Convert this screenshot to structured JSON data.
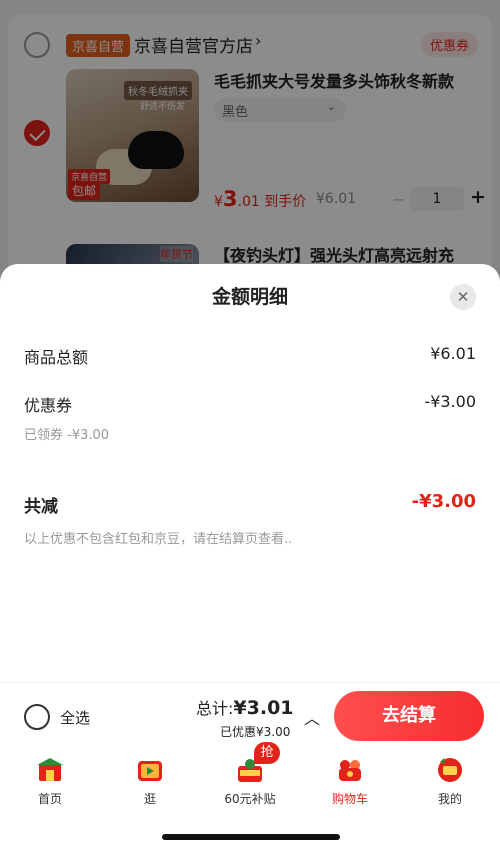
{
  "shop": {
    "badge": "京喜自营",
    "name": "京喜自营官方店",
    "chevron": "›",
    "coupon": "优惠券"
  },
  "product1": {
    "title": "毛毛抓夹大号发量多头饰秋冬新款",
    "spec": "黑色",
    "spec_arrow": "⌄",
    "image_tag_top": "秋冬毛绒抓夹",
    "image_tag_sub": "舒适不伤发",
    "image_tag_store": "京喜自营",
    "image_tag_ship": "包邮",
    "price_symbol": "¥",
    "price_int": "3",
    "price_dec": ".01",
    "price_note": "到手价",
    "price_old": "¥6.01",
    "qty_minus": "−",
    "qty": "1",
    "qty_plus": "+"
  },
  "product2": {
    "title": "【夜钓头灯】强光头灯高亮远射充",
    "image_tag": "年货节"
  },
  "sheet": {
    "title": "金额明细",
    "close": "✕",
    "goods_total_label": "商品总额",
    "goods_total_value": "¥6.01",
    "coupon_label": "优惠券",
    "coupon_value": "-¥3.00",
    "coupon_sub": "已领券 -¥3.00",
    "total_reduce_label": "共减",
    "total_reduce_value": "-¥3.00",
    "note": "以上优惠不包含红包和京豆，请在结算页查看.."
  },
  "checkout": {
    "select_all": "全选",
    "sum_prefix": "总计:",
    "sum_value": "¥3.01",
    "saved": "已优惠¥3.00",
    "caret": "︿",
    "pay": "去结算"
  },
  "tabs": [
    {
      "label": "首页",
      "icon": "home-icon"
    },
    {
      "label": "逛",
      "icon": "video-icon"
    },
    {
      "label": "60元补贴",
      "icon": "subsidy-icon",
      "badge": "抢"
    },
    {
      "label": "购物车",
      "icon": "cart-icon",
      "active": true
    },
    {
      "label": "我的",
      "icon": "profile-icon"
    }
  ],
  "colors": {
    "accent": "#e2231a",
    "shop_badge": "#e45f1e"
  }
}
